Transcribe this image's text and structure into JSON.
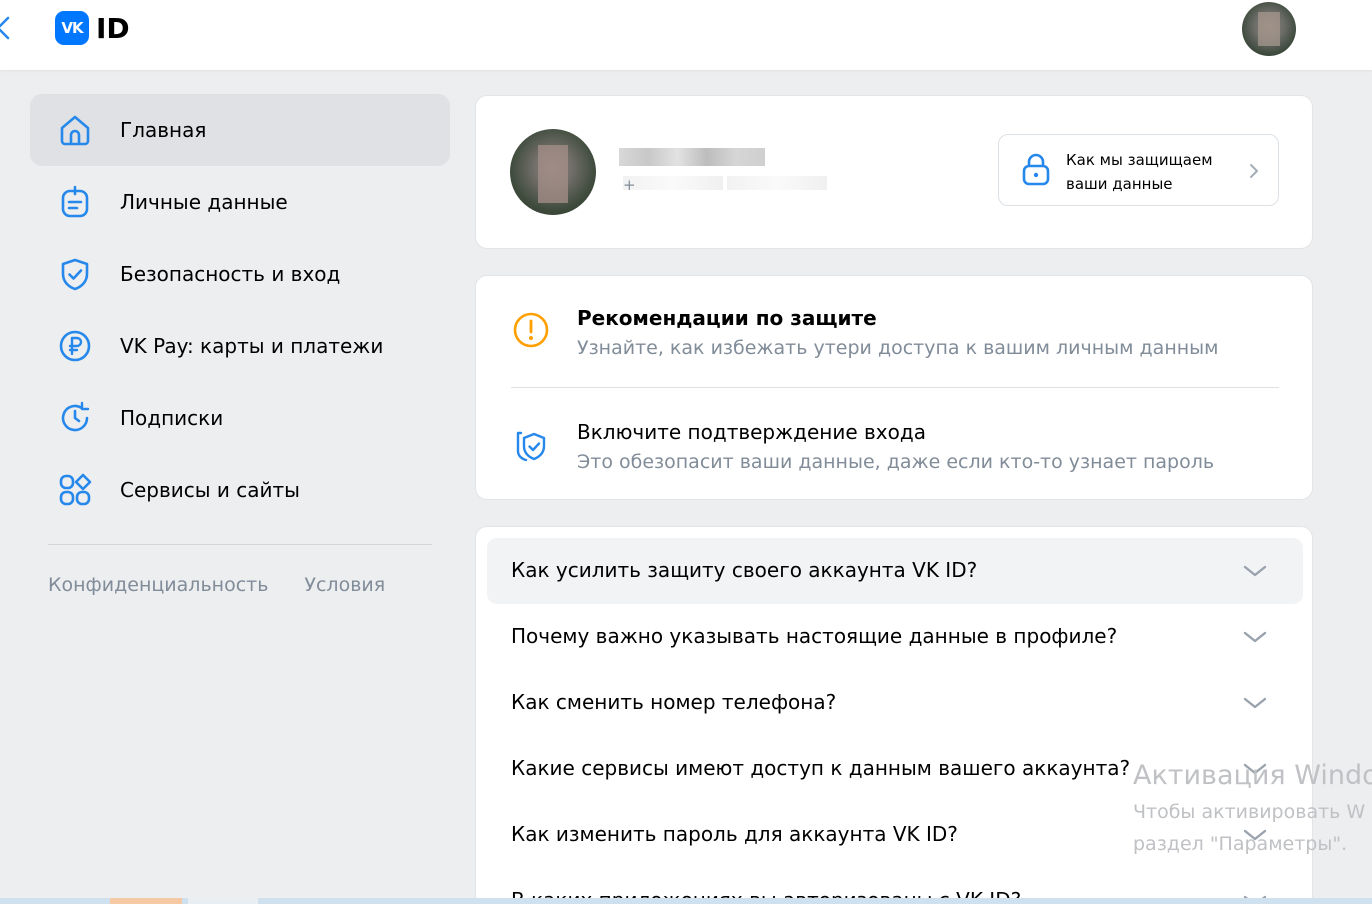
{
  "header": {
    "logo_badge": "VK",
    "logo_text": "ID"
  },
  "sidebar": {
    "items": [
      {
        "label": "Главная",
        "icon": "home-icon",
        "active": true
      },
      {
        "label": "Личные данные",
        "icon": "personal-data-icon",
        "active": false
      },
      {
        "label": "Безопасность и вход",
        "icon": "shield-icon",
        "active": false
      },
      {
        "label": "VK Pay: карты и платежи",
        "icon": "ruble-icon",
        "active": false
      },
      {
        "label": "Подписки",
        "icon": "subscription-icon",
        "active": false
      },
      {
        "label": "Сервисы и сайты",
        "icon": "services-icon",
        "active": false
      }
    ],
    "links": [
      "Конфиденциальность",
      "Условия"
    ]
  },
  "profile": {
    "phone_prefix": "+",
    "protect_link": "Как мы защищаем ваши данные"
  },
  "recommendations": {
    "items": [
      {
        "title": "Рекомендации по защите",
        "subtitle": "Узнайте, как избежать утери доступа к вашим личным данным",
        "icon": "warning-icon"
      },
      {
        "title": "Включите подтверждение входа",
        "subtitle": "Это обезопасит ваши данные, даже если кто-то узнает пароль",
        "icon": "two-factor-shield-icon"
      }
    ]
  },
  "faq": {
    "items": [
      "Как усилить защиту своего аккаунта VK ID?",
      "Почему важно указывать настоящие данные в профиле?",
      "Как сменить номер телефона?",
      "Какие сервисы имеют доступ к данным вашего аккаунта?",
      "Как изменить пароль для аккаунта VK ID?",
      "В каких приложениях вы авторизованы с VK ID?"
    ]
  },
  "watermark": {
    "title": "Активация Windo",
    "line1": "Чтобы активировать W",
    "line2": "раздел \"Параметры\"."
  },
  "colors": {
    "accent": "#0077ff",
    "warning": "#ffa000",
    "page_bg": "#edeef0",
    "muted_text": "#818c99"
  }
}
